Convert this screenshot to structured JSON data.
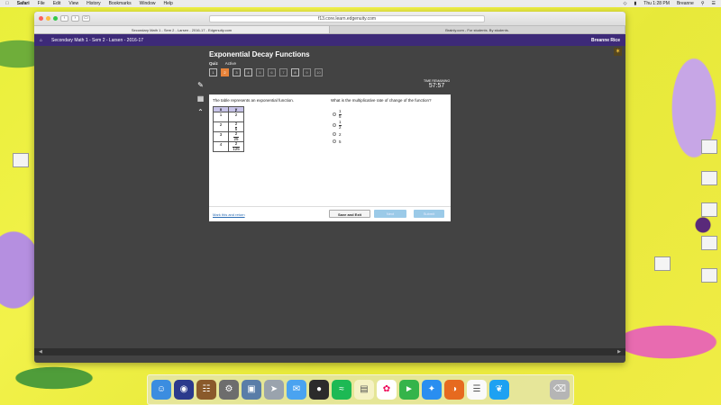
{
  "menubar": {
    "apple": "",
    "app_name": "Safari",
    "menus": [
      "File",
      "Edit",
      "View",
      "History",
      "Bookmarks",
      "Window",
      "Help"
    ],
    "clock": "Thu 1:28 PM",
    "user": "Breanne"
  },
  "browser": {
    "url": "f13.core.learn.edgenuity.com",
    "tabs": [
      "Secondary Math 1 - Sem 2 - Larsen - 2016-17 - Edgenuity.com",
      "Brainly.com - For students. By students."
    ]
  },
  "site": {
    "course": "Secondary Math 1 - Sem 2 - Larsen - 2016-17",
    "user": "Breanne Rice"
  },
  "quiz": {
    "title": "Exponential Decay Functions",
    "type": "Quiz",
    "status": "Active",
    "question_numbers": [
      "1",
      "2",
      "3",
      "4",
      "5",
      "6",
      "7",
      "8",
      "9",
      "10"
    ],
    "current_question": 2,
    "timer_label": "TIME REMAINING",
    "timer_value": "57:57"
  },
  "question": {
    "prompt_left": "The table represents an exponential function.",
    "prompt_right": "What is the multiplicative rate of change of the function?",
    "table_headers": [
      "x",
      "y"
    ],
    "table_rows": [
      {
        "x": "1",
        "y_num": "2",
        "y_den": ""
      },
      {
        "x": "2",
        "y_num": "2",
        "y_den": "5"
      },
      {
        "x": "3",
        "y_num": "2",
        "y_den": "25"
      },
      {
        "x": "4",
        "y_num": "2",
        "y_den": "125"
      }
    ],
    "choices": [
      {
        "num": "1",
        "den": "5"
      },
      {
        "num": "1",
        "den": "2"
      },
      {
        "text": "2"
      },
      {
        "text": "5"
      }
    ]
  },
  "footer": {
    "mark_link": "Mark this and return",
    "save_exit": "Save and Exit",
    "next": "Next",
    "submit": "Submit"
  }
}
